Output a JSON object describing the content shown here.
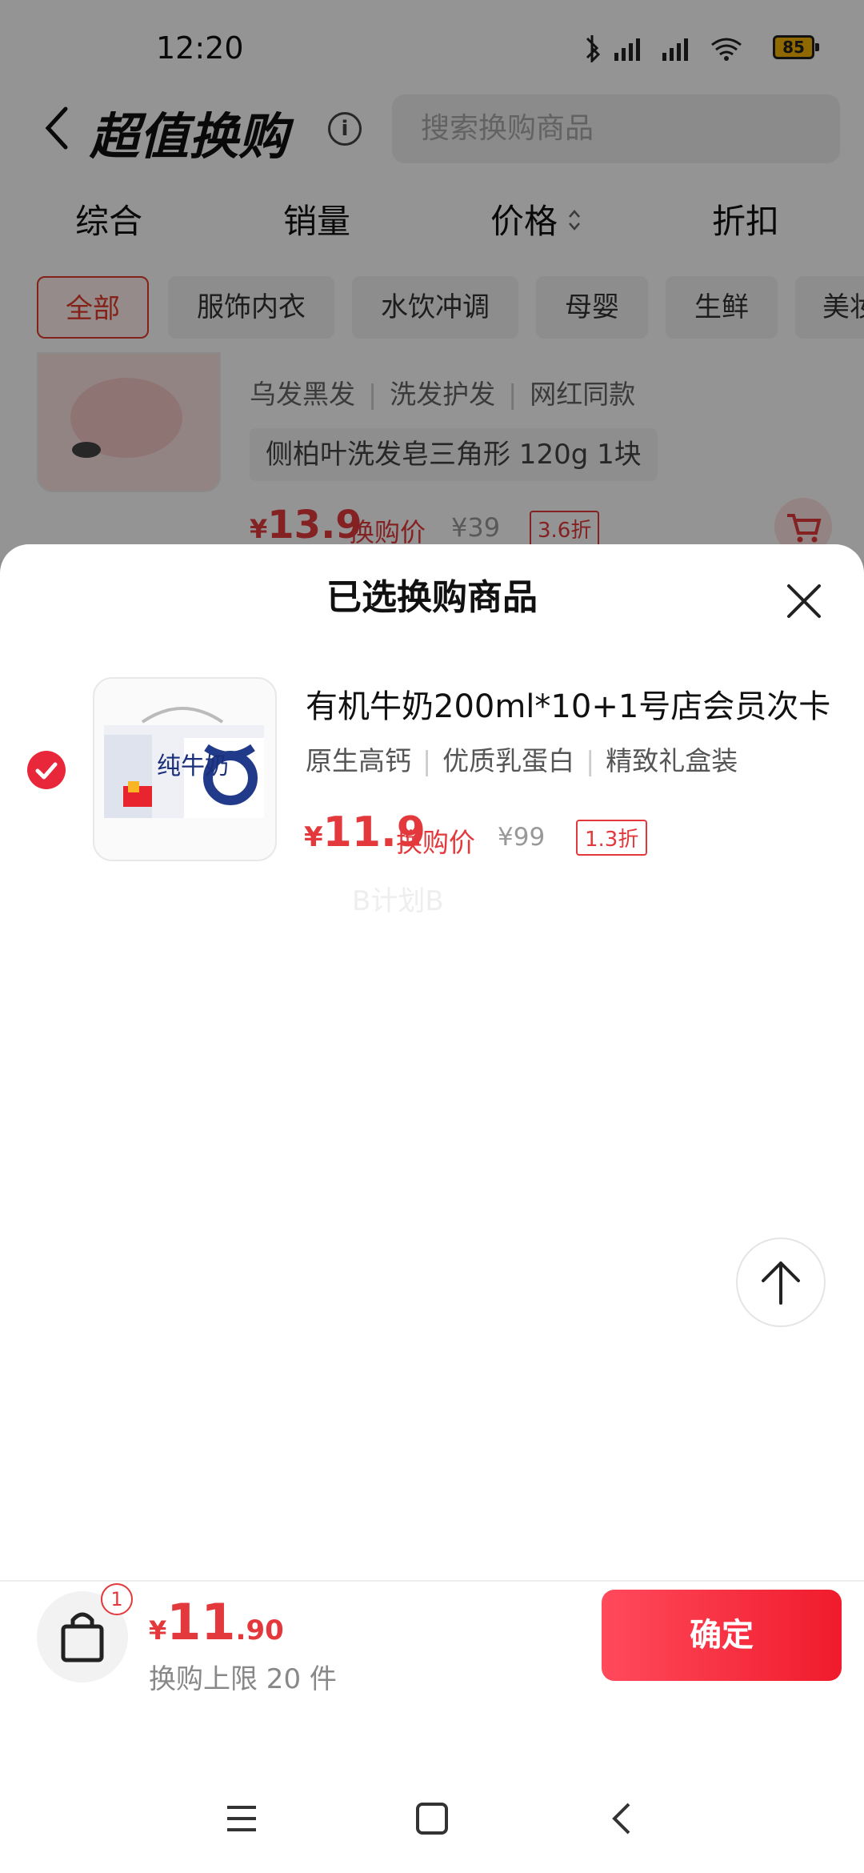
{
  "status_bar": {
    "time": "12:20",
    "battery": "85"
  },
  "header": {
    "title": "超值换购",
    "search_placeholder": "搜索换购商品"
  },
  "sort_tabs": [
    "综合",
    "销量",
    "价格",
    "折扣"
  ],
  "categories": [
    "全部",
    "服饰内衣",
    "水饮冲调",
    "母婴",
    "生鲜",
    "美妆"
  ],
  "background_product": {
    "tags": [
      "乌发黑发",
      "洗发护发",
      "网红同款"
    ],
    "name": "侧柏叶洗发皂三角形 120g 1块",
    "price": "13.9",
    "price_label": "换购价",
    "original_price": "¥39",
    "discount": "3.6折"
  },
  "sheet": {
    "title": "已选换购商品",
    "product": {
      "name": "有机牛奶200ml*10+1号店会员次卡",
      "tags": [
        "原生高钙",
        "优质乳蛋白",
        "精致礼盒装"
      ],
      "price": "11.9",
      "price_label": "换购价",
      "original_price": "¥99",
      "discount": "1.3折",
      "thumb_text": "纯牛奶"
    },
    "watermark": "B计划B"
  },
  "footer": {
    "bag_count": "1",
    "total_int": "11",
    "total_dec": ".90",
    "limit": "换购上限 20 件",
    "confirm": "确定"
  },
  "colors": {
    "accent": "#e4393c",
    "confirm_start": "#ff4a5c",
    "confirm_end": "#f01b2c"
  }
}
